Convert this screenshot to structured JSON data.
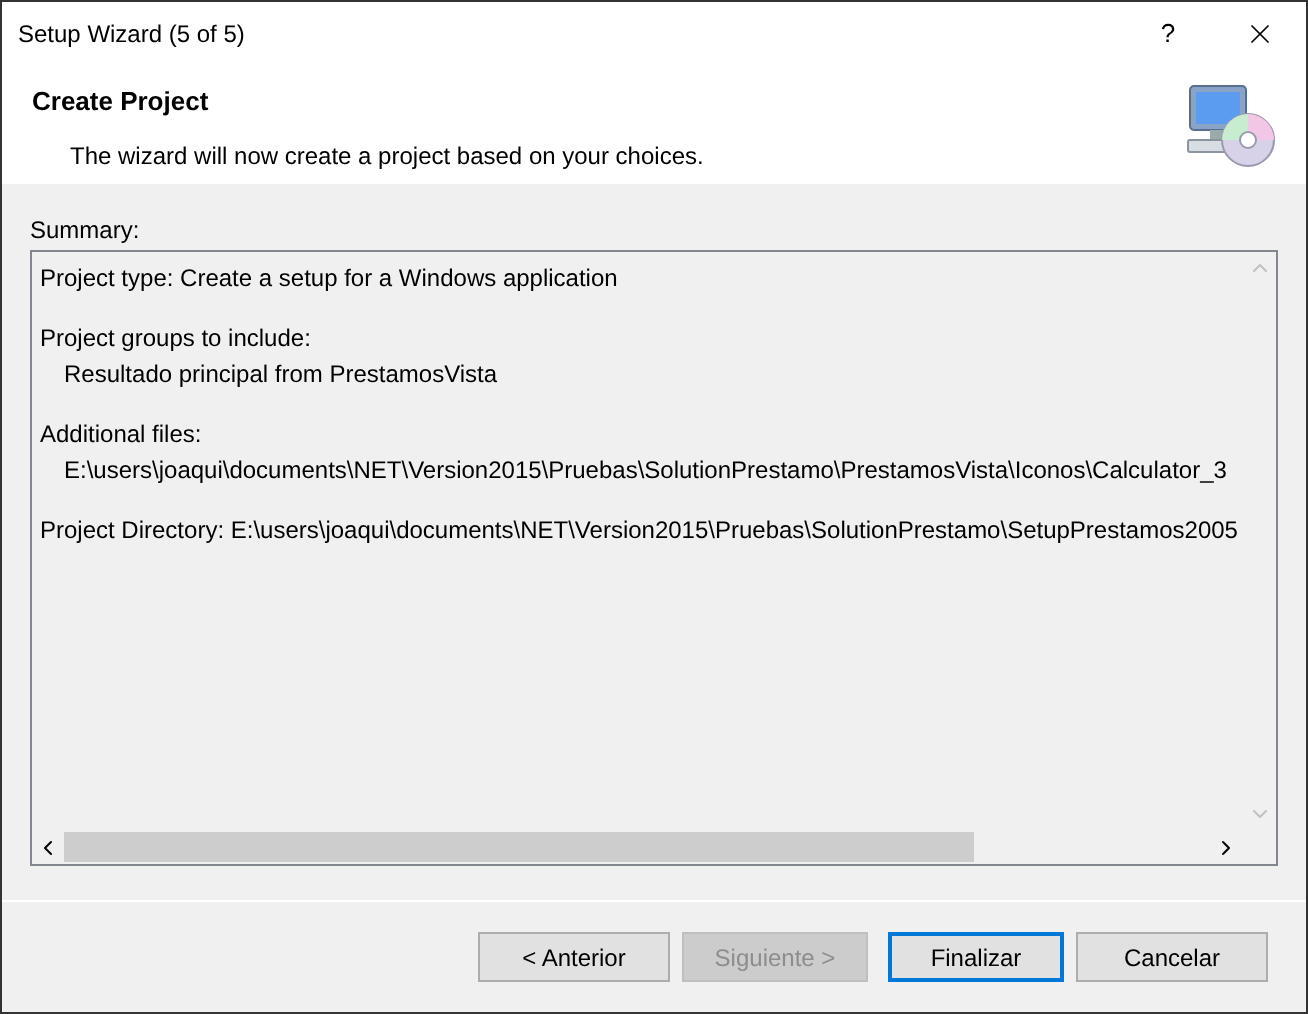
{
  "window": {
    "title": "Setup Wizard (5 of 5)",
    "help": "?"
  },
  "header": {
    "title": "Create Project",
    "subtitle": "The wizard will now create a project based on your choices."
  },
  "summary": {
    "label": "Summary:",
    "sections": [
      {
        "text": "Project type: Create a setup for a Windows application"
      },
      {
        "text": "Project groups to include:",
        "children": [
          "Resultado principal from PrestamosVista"
        ]
      },
      {
        "text": "Additional files:",
        "children": [
          "E:\\users\\joaqui\\documents\\NET\\Version2015\\Pruebas\\SolutionPrestamo\\PrestamosVista\\Iconos\\Calculator_3"
        ]
      },
      {
        "text": "Project Directory: E:\\users\\joaqui\\documents\\NET\\Version2015\\Pruebas\\SolutionPrestamo\\SetupPrestamos2005"
      }
    ]
  },
  "buttons": [
    {
      "label": "< Anterior",
      "disabled": false,
      "default": false
    },
    {
      "label": "Siguiente >",
      "disabled": true,
      "default": false
    },
    {
      "label": "Finalizar",
      "disabled": false,
      "default": true
    },
    {
      "label": "Cancelar",
      "disabled": false,
      "default": false
    }
  ]
}
